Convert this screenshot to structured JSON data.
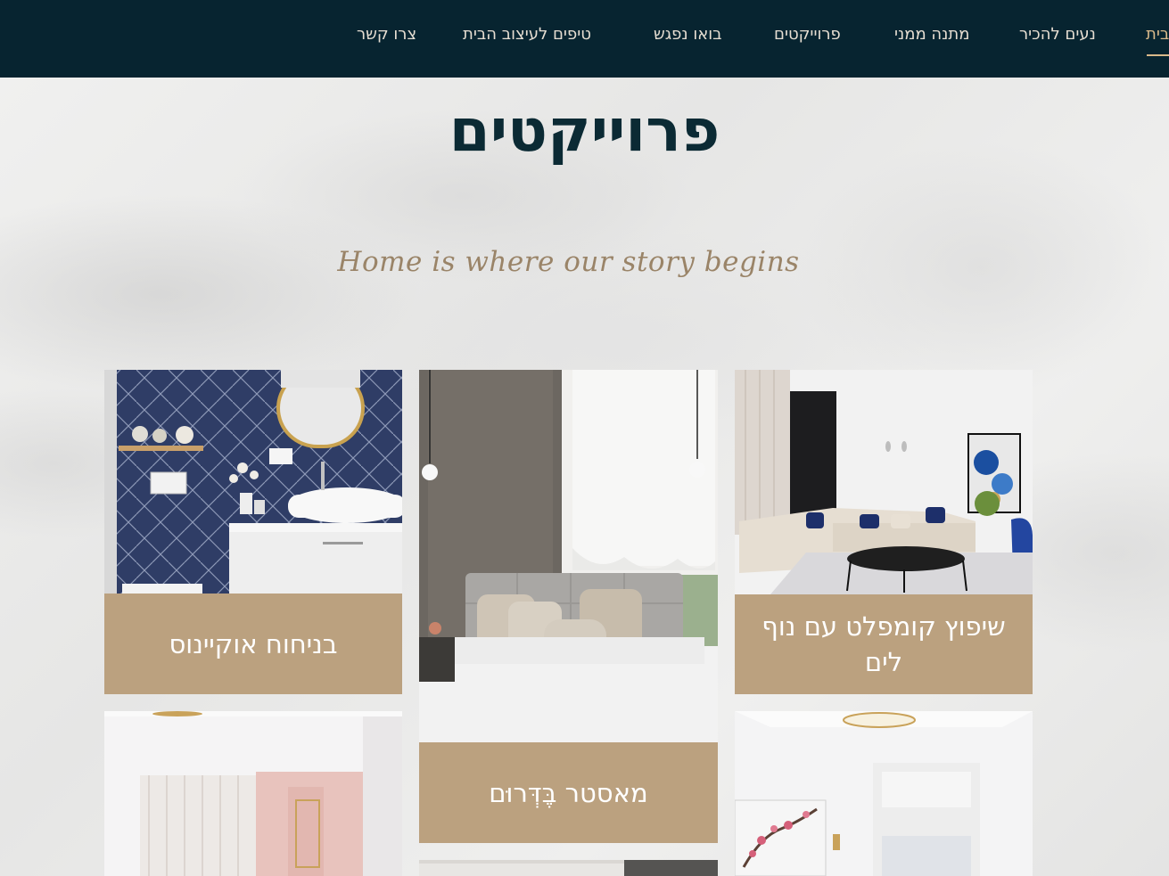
{
  "nav": {
    "items": [
      {
        "label": "בית",
        "active": true
      },
      {
        "label": "נעים להכיר",
        "active": false
      },
      {
        "label": "מתנה ממני",
        "active": false
      },
      {
        "label": "פרוייקטים",
        "active": false
      },
      {
        "label": "בואו נפגש",
        "active": false
      },
      {
        "label": "טיפים לעיצוב הבית",
        "active": false
      },
      {
        "label": "צרו קשר",
        "active": false
      }
    ]
  },
  "page": {
    "title": "פרוייקטים",
    "tagline": "Home is where our story begins"
  },
  "projects": [
    {
      "title": "בניחוח אוקיינוס",
      "image": "navy herringbone bathroom"
    },
    {
      "title": "מאסטר בֶּדְּרוּם",
      "image": "master bedroom"
    },
    {
      "title": "שיפוץ קומפלט עם נוף לים",
      "image": "living room with sofa"
    }
  ],
  "colors": {
    "nav_bg": "#072430",
    "accent": "#bba17f",
    "title": "#0b2a34"
  }
}
